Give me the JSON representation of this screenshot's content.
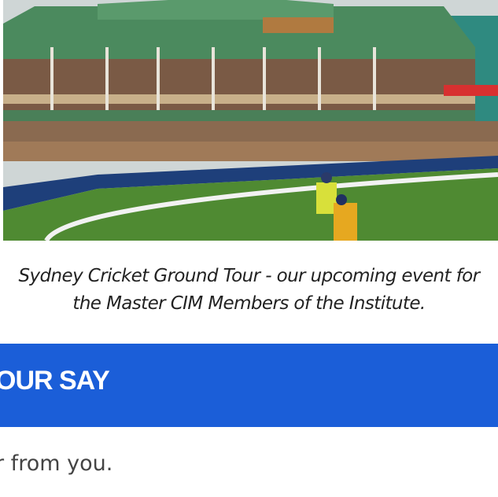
{
  "image": {
    "subject": "cricket-ground-pavilion-photo",
    "colors": {
      "grass": "#4f8a32",
      "roof": "#4b8a5e",
      "sky": "#d9dfe1",
      "boundary_board": "#1e3f7a"
    }
  },
  "caption": {
    "line1": "Sydney Cricket Ground Tour - our upcoming event for",
    "line2": "the Master CIM Members of the Institute."
  },
  "banner": {
    "title": "OUR SAY",
    "color": "#1b5ed8"
  },
  "body": {
    "text": "r from you."
  }
}
